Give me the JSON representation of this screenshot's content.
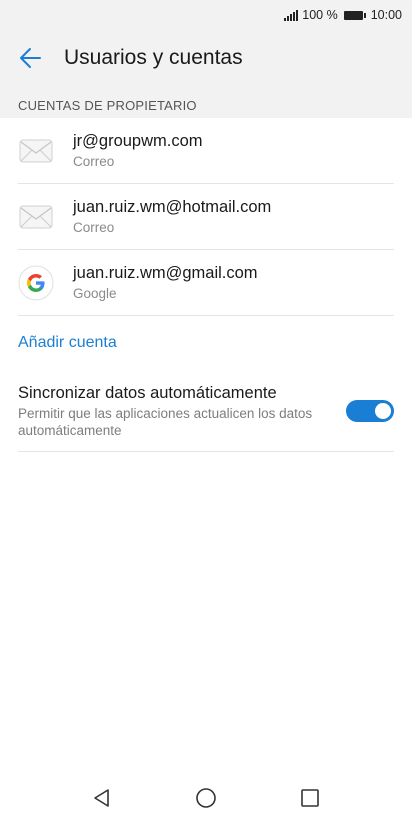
{
  "status_bar": {
    "battery": "100 %",
    "time": "10:00"
  },
  "header": {
    "back_icon": "arrow-left-icon",
    "title": "Usuarios y cuentas"
  },
  "section": {
    "header": "CUENTAS DE PROPIETARIO"
  },
  "accounts": [
    {
      "email": "jr@groupwm.com",
      "type": "Correo",
      "icon": "mail-icon"
    },
    {
      "email": "juan.ruiz.wm@hotmail.com",
      "type": "Correo",
      "icon": "mail-icon"
    },
    {
      "email": "juan.ruiz.wm@gmail.com",
      "type": "Google",
      "icon": "google-icon"
    }
  ],
  "add_account_label": "Añadir cuenta",
  "sync": {
    "title": "Sincronizar datos automáticamente",
    "description": "Permitir que las aplicaciones actualicen los datos automáticamente",
    "enabled": true
  },
  "colors": {
    "accent": "#1a7fd4",
    "background": "#f2f2f2"
  },
  "nav_icons": [
    "back-triangle-icon",
    "home-circle-icon",
    "recents-square-icon"
  ]
}
